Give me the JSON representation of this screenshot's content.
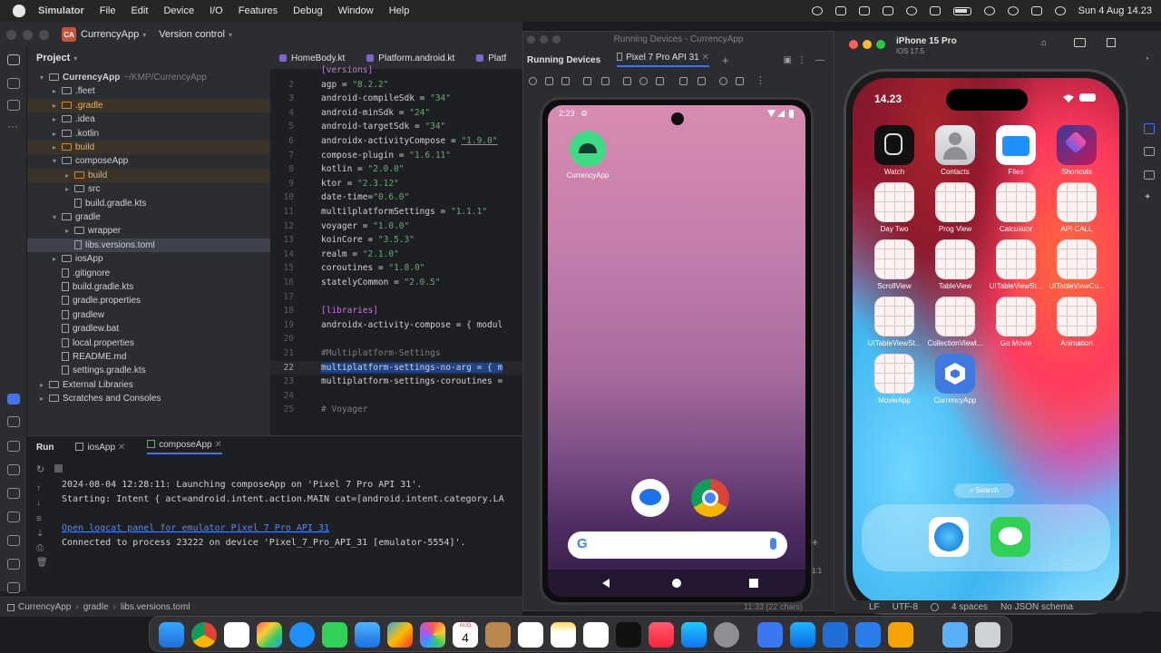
{
  "menubar": {
    "app": "Simulator",
    "items": [
      "File",
      "Edit",
      "Device",
      "I/O",
      "Features",
      "Debug",
      "Window",
      "Help"
    ],
    "datetime": "Sun 4 Aug  14.23"
  },
  "ide": {
    "project_badge": "CA",
    "project_name": "CurrencyApp",
    "vcs": "Version control",
    "panel_title": "Project",
    "tree": [
      {
        "label": "CurrencyApp",
        "hint": "~/KMP/CurrencyApp",
        "indent": 0,
        "kind": "folder",
        "open": true
      },
      {
        "label": ".fleet",
        "indent": 1,
        "kind": "folder"
      },
      {
        "label": ".gradle",
        "indent": 1,
        "kind": "folder",
        "orange": true
      },
      {
        "label": ".idea",
        "indent": 1,
        "kind": "folder"
      },
      {
        "label": ".kotlin",
        "indent": 1,
        "kind": "folder"
      },
      {
        "label": "build",
        "indent": 1,
        "kind": "folder",
        "orange": true
      },
      {
        "label": "composeApp",
        "indent": 1,
        "kind": "folder",
        "open": true
      },
      {
        "label": "build",
        "indent": 2,
        "kind": "folder",
        "orange": true
      },
      {
        "label": "src",
        "indent": 2,
        "kind": "folder"
      },
      {
        "label": "build.gradle.kts",
        "indent": 2,
        "kind": "file"
      },
      {
        "label": "gradle",
        "indent": 1,
        "kind": "folder",
        "open": true
      },
      {
        "label": "wrapper",
        "indent": 2,
        "kind": "folder"
      },
      {
        "label": "libs.versions.toml",
        "indent": 2,
        "kind": "file",
        "selected": true
      },
      {
        "label": "iosApp",
        "indent": 1,
        "kind": "folder"
      },
      {
        "label": ".gitignore",
        "indent": 1,
        "kind": "file"
      },
      {
        "label": "build.gradle.kts",
        "indent": 1,
        "kind": "file"
      },
      {
        "label": "gradle.properties",
        "indent": 1,
        "kind": "file"
      },
      {
        "label": "gradlew",
        "indent": 1,
        "kind": "file"
      },
      {
        "label": "gradlew.bat",
        "indent": 1,
        "kind": "file"
      },
      {
        "label": "local.properties",
        "indent": 1,
        "kind": "file"
      },
      {
        "label": "README.md",
        "indent": 1,
        "kind": "file"
      },
      {
        "label": "settings.gradle.kts",
        "indent": 1,
        "kind": "file"
      },
      {
        "label": "External Libraries",
        "indent": 0,
        "kind": "folder"
      },
      {
        "label": "Scratches and Consoles",
        "indent": 0,
        "kind": "folder"
      }
    ],
    "editor_tabs": [
      "HomeBody.kt",
      "Platform.android.kt",
      "Platf"
    ],
    "code": [
      {
        "n": "",
        "text": "[versions]"
      },
      {
        "n": "2",
        "text": "agp = \"8.2.2\""
      },
      {
        "n": "3",
        "text": "android-compileSdk = \"34\""
      },
      {
        "n": "4",
        "text": "android-minSdk = \"24\""
      },
      {
        "n": "5",
        "text": "android-targetSdk = \"34\""
      },
      {
        "n": "6",
        "text": "androidx-activityCompose = \"1.9.0\""
      },
      {
        "n": "7",
        "text": "compose-plugin = \"1.6.11\""
      },
      {
        "n": "8",
        "text": "kotlin = \"2.0.0\""
      },
      {
        "n": "9",
        "text": "ktor = \"2.3.12\""
      },
      {
        "n": "10",
        "text": "date-time=\"0.6.0\""
      },
      {
        "n": "11",
        "text": "multilplatformSettings = \"1.1.1\""
      },
      {
        "n": "12",
        "text": "voyager = \"1.0.0\""
      },
      {
        "n": "13",
        "text": "koinCore = \"3.5.3\""
      },
      {
        "n": "14",
        "text": "realm = \"2.1.0\""
      },
      {
        "n": "15",
        "text": "coroutines = \"1.8.0\""
      },
      {
        "n": "16",
        "text": "statelyCommon = \"2.0.5\""
      },
      {
        "n": "17",
        "text": ""
      },
      {
        "n": "18",
        "text": "[libraries]"
      },
      {
        "n": "19",
        "text": "androidx-activity-compose = { modul"
      },
      {
        "n": "20",
        "text": ""
      },
      {
        "n": "21",
        "text": "#Multiplatform-Settings"
      },
      {
        "n": "22",
        "text": "multiplatform-settings-no-arg = { m"
      },
      {
        "n": "23",
        "text": "multiplatform-settings-coroutines ="
      },
      {
        "n": "24",
        "text": ""
      },
      {
        "n": "25",
        "text": "# Voyager"
      }
    ],
    "run": {
      "title": "Run",
      "tabs": [
        "iosApp",
        "composeApp"
      ],
      "lines": [
        "2024-08-04 12:28:11: Launching composeApp on 'Pixel 7 Pro API 31'.",
        "Starting: Intent { act=android.intent.action.MAIN cat=[android.intent.category.LA",
        "",
        "Open logcat panel for emulator Pixel 7 Pro API 31",
        "Connected to process 23222 on device 'Pixel_7_Pro_API_31 [emulator-5554]'."
      ]
    },
    "statusbar": {
      "crumbs": [
        "CurrencyApp",
        "gradle",
        "libs.versions.toml"
      ],
      "chars": "11:33 (22 chars)",
      "le": "LF",
      "enc": "UTF-8",
      "indent": "4 spaces",
      "schema": "No JSON schema"
    }
  },
  "running_devices": {
    "window_title": "Running Devices - CurrencyApp",
    "panel_label": "Running Devices",
    "device_tab": "Pixel 7 Pro API 31",
    "zoom": "1:1",
    "android": {
      "time": "2:23",
      "app_label": "CurrencyApp"
    }
  },
  "ios_sim": {
    "device": "iPhone 15 Pro",
    "os": "iOS 17.5",
    "time": "14.23",
    "apps": [
      {
        "label": "Watch",
        "kind": "watch"
      },
      {
        "label": "Contacts",
        "kind": "contacts"
      },
      {
        "label": "Files",
        "kind": "files"
      },
      {
        "label": "Shortcuts",
        "kind": "shortcuts"
      },
      {
        "label": "Day Two",
        "kind": "placeholder"
      },
      {
        "label": "Prog View",
        "kind": "placeholder"
      },
      {
        "label": "Calculator",
        "kind": "placeholder"
      },
      {
        "label": "API CALL",
        "kind": "placeholder"
      },
      {
        "label": "ScrollView",
        "kind": "placeholder"
      },
      {
        "label": "TableView",
        "kind": "placeholder"
      },
      {
        "label": "UITableViewSt...",
        "kind": "placeholder"
      },
      {
        "label": "UITableViewCu...",
        "kind": "placeholder"
      },
      {
        "label": "UITableViewSt...",
        "kind": "placeholder"
      },
      {
        "label": "CollectionViewl...",
        "kind": "placeholder"
      },
      {
        "label": "Go Movie",
        "kind": "placeholder"
      },
      {
        "label": "Animation",
        "kind": "placeholder"
      },
      {
        "label": "MovieApp",
        "kind": "placeholder"
      },
      {
        "label": "CurrencyApp",
        "kind": "currency"
      }
    ],
    "search": "Search"
  },
  "dock": {
    "calendar_day": "4",
    "calendar_month": "AUG"
  },
  "colors": {
    "accent": "#4573e8",
    "ide_bg": "#1e1f22",
    "panel_bg": "#2b2d30"
  }
}
